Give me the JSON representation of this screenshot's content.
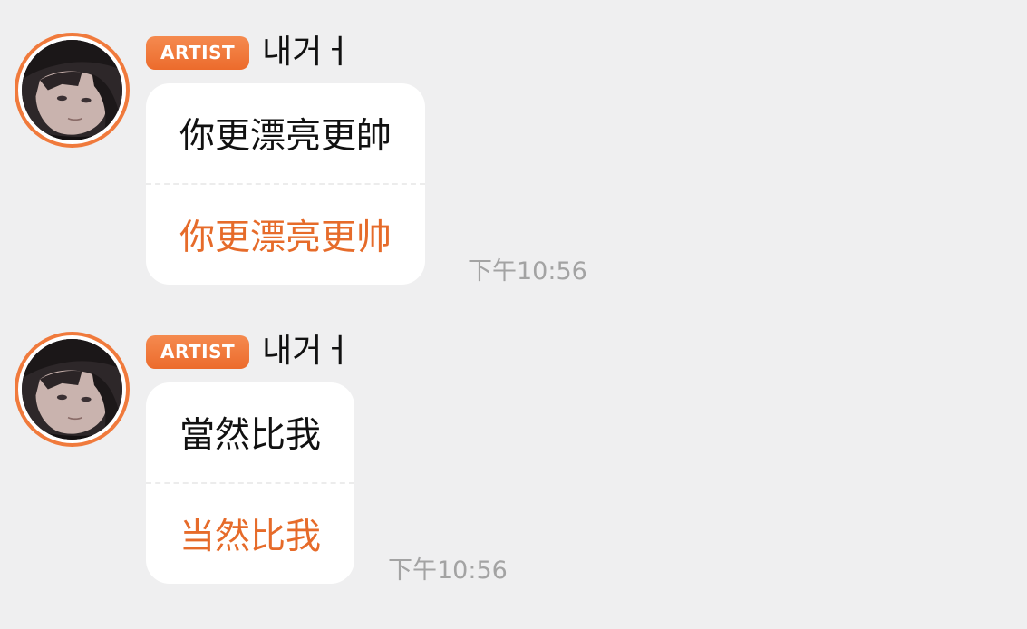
{
  "messages": [
    {
      "badge": "ARTIST",
      "sender": "내거ㅓ",
      "original": "你更漂亮更帥",
      "translated": "你更漂亮更帅",
      "time": "下午10:56"
    },
    {
      "badge": "ARTIST",
      "sender": "내거ㅓ",
      "original": "當然比我",
      "translated": "当然比我",
      "time": "下午10:56"
    }
  ],
  "colors": {
    "accent": "#ec6b2c",
    "translated_text": "#e66b2a",
    "background": "#efeff0",
    "bubble": "#ffffff",
    "timestamp": "#a3a3a3"
  }
}
